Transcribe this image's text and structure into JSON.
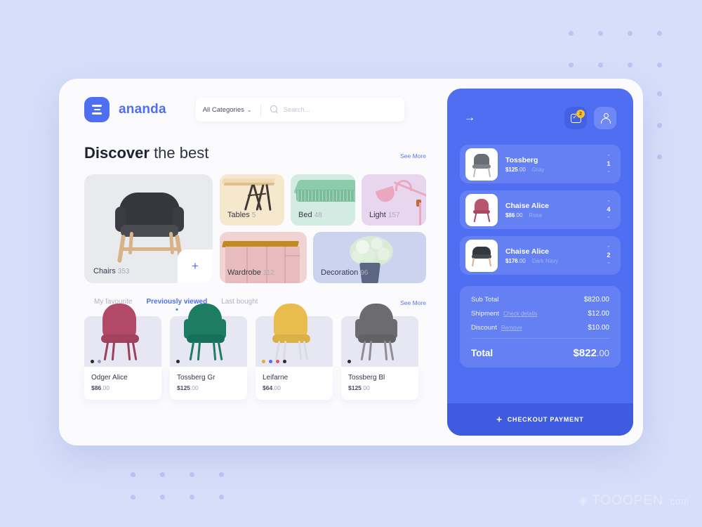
{
  "brand": {
    "name": "ananda",
    "logo_icon": "menu-lines-icon"
  },
  "search": {
    "category_label": "All Categories",
    "caret_icon": "chevron-down-icon",
    "icon": "search-icon",
    "placeholder": "Search..."
  },
  "discover": {
    "title_bold": "Discover",
    "title_rest": " the best",
    "see_more": "See More",
    "add_button": "+"
  },
  "categories": [
    {
      "label": "Chairs",
      "count": "353",
      "color": "#e9eaee"
    },
    {
      "label": "Tables",
      "count": "5",
      "color": "#f6e8cc"
    },
    {
      "label": "Bed",
      "count": "48",
      "color": "#d3ece3"
    },
    {
      "label": "Light",
      "count": "157",
      "color": "#e8d6ee"
    },
    {
      "label": "Wardrobe",
      "count": "112",
      "color": "#f2d3d3"
    },
    {
      "label": "Decoration",
      "count": "96",
      "color": "#ccd3ef"
    }
  ],
  "tabs": {
    "items": [
      {
        "label": "My favourite",
        "active": false
      },
      {
        "label": "Previously viewed",
        "active": true
      },
      {
        "label": "Last bought",
        "active": false
      }
    ],
    "see_more": "See More"
  },
  "products": [
    {
      "name": "Odger Alice",
      "price": "$86",
      "cents": ".00",
      "swatches": [
        "#2b2b2b",
        "#9aa0b2"
      ],
      "body": "#b04a68",
      "legs": "#9c3f5b"
    },
    {
      "name": "Tossberg Gr",
      "price": "$125",
      "cents": ".00",
      "swatches": [
        "#2b2b2b"
      ],
      "body": "#1d7d63",
      "legs": "#1d7d63"
    },
    {
      "name": "Leifarne",
      "price": "$64",
      "cents": ".00",
      "swatches": [
        "#e0a93c",
        "#4f6ef2",
        "#e05569",
        "#2b2b2b"
      ],
      "body": "#e8bd4e",
      "legs": "#d8d8d8"
    },
    {
      "name": "Tossberg Bl",
      "price": "$125",
      "cents": ".00",
      "swatches": [
        "#2b2b2b"
      ],
      "body": "#6c6c70",
      "legs": "#8d8d92"
    }
  ],
  "cart": {
    "back_icon": "arrow-right-icon",
    "bag_icon": "shopping-bag-icon",
    "bag_badge": "2",
    "account_icon": "person-icon",
    "items": [
      {
        "name": "Tossberg",
        "price": "$125",
        "cents": ".00",
        "color": "Gray",
        "qty": "1"
      },
      {
        "name": "Chaise Alice",
        "price": "$86",
        "cents": ".00",
        "color": "Rose",
        "qty": "4"
      },
      {
        "name": "Chaise Alice",
        "price": "$176",
        "cents": ".00",
        "color": "Dark Navy",
        "qty": "2"
      }
    ],
    "stepper_up_icon": "chevron-up-icon",
    "stepper_down_icon": "chevron-down-icon",
    "summary": {
      "subtotal_label": "Sub Total",
      "subtotal_value": "$820.00",
      "shipment_label": "Shipment",
      "shipment_link": "Check details",
      "shipment_value": "$12.00",
      "discount_label": "Discount",
      "discount_link": "Remove",
      "discount_value": "$10.00",
      "total_label": "Total",
      "total_value": "$822",
      "total_cents": ".00"
    },
    "checkout_icon": "plus-icon",
    "checkout_label": "CHECKOUT PAYMENT"
  },
  "watermark": {
    "logo": "◈",
    "name": "TOOOPEN",
    "suffix": ".com"
  },
  "theme": {
    "accent": "#4f6ef2",
    "page_bg": "#d7defa",
    "cart_bg": "#4f6ef2",
    "checkout_bg": "#3f5ce0",
    "badge": "#fbc02d"
  }
}
